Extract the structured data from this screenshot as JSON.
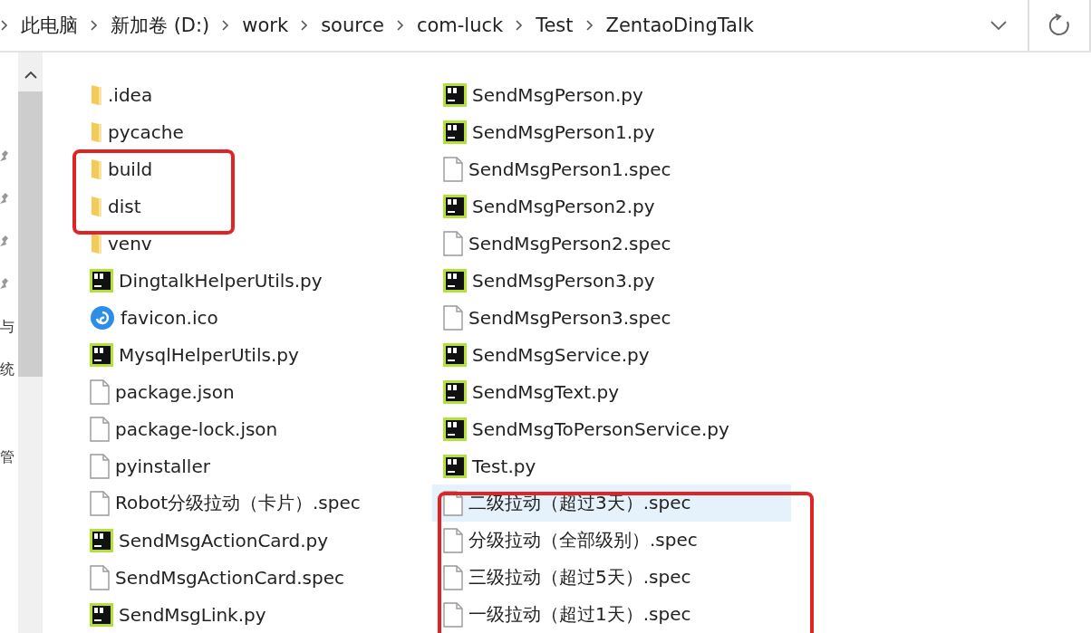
{
  "breadcrumb": {
    "segments": [
      "此电脑",
      "新加卷 (D:)",
      "work",
      "source",
      "com-luck",
      "Test",
      "ZentaoDingTalk"
    ]
  },
  "nav": [
    {
      "kind": "pin"
    },
    {
      "kind": "pin"
    },
    {
      "kind": "pin"
    },
    {
      "kind": "pin"
    },
    {
      "kind": "label",
      "text": "与"
    },
    {
      "kind": "label",
      "text": "统"
    },
    {
      "kind": "label",
      "text": "管"
    }
  ],
  "columns": [
    {
      "items": [
        {
          "name": ".idea",
          "kind": "folder",
          "selected": false
        },
        {
          "name": "pycache",
          "kind": "folder",
          "selected": false
        },
        {
          "name": "build",
          "kind": "folder",
          "selected": false
        },
        {
          "name": "dist",
          "kind": "folder",
          "selected": false
        },
        {
          "name": "venv",
          "kind": "folder",
          "selected": false
        },
        {
          "name": "DingtalkHelperUtils.py",
          "kind": "python",
          "selected": false
        },
        {
          "name": "favicon.ico",
          "kind": "ico",
          "selected": false
        },
        {
          "name": "MysqlHelperUtils.py",
          "kind": "python",
          "selected": false
        },
        {
          "name": "package.json",
          "kind": "file",
          "selected": false
        },
        {
          "name": "package-lock.json",
          "kind": "file",
          "selected": false
        },
        {
          "name": "pyinstaller",
          "kind": "file",
          "selected": false
        },
        {
          "name": "Robot分级拉动（卡片）.spec",
          "kind": "file",
          "selected": false
        },
        {
          "name": "SendMsgActionCard.py",
          "kind": "python",
          "selected": false
        },
        {
          "name": "SendMsgActionCard.spec",
          "kind": "file",
          "selected": false
        },
        {
          "name": "SendMsgLink.py",
          "kind": "python",
          "selected": false
        }
      ]
    },
    {
      "items": [
        {
          "name": "SendMsgPerson.py",
          "kind": "python",
          "selected": false
        },
        {
          "name": "SendMsgPerson1.py",
          "kind": "python",
          "selected": false
        },
        {
          "name": "SendMsgPerson1.spec",
          "kind": "file",
          "selected": false
        },
        {
          "name": "SendMsgPerson2.py",
          "kind": "python",
          "selected": false
        },
        {
          "name": "SendMsgPerson2.spec",
          "kind": "file",
          "selected": false
        },
        {
          "name": "SendMsgPerson3.py",
          "kind": "python",
          "selected": false
        },
        {
          "name": "SendMsgPerson3.spec",
          "kind": "file",
          "selected": false
        },
        {
          "name": "SendMsgService.py",
          "kind": "python",
          "selected": false
        },
        {
          "name": "SendMsgText.py",
          "kind": "python",
          "selected": false
        },
        {
          "name": "SendMsgToPersonService.py",
          "kind": "python",
          "selected": false
        },
        {
          "name": "Test.py",
          "kind": "python",
          "selected": false
        },
        {
          "name": "二级拉动（超过3天）.spec",
          "kind": "file",
          "selected": true
        },
        {
          "name": "分级拉动（全部级别）.spec",
          "kind": "file",
          "selected": false
        },
        {
          "name": "三级拉动（超过5天）.spec",
          "kind": "file",
          "selected": false
        },
        {
          "name": "一级拉动（超过1天）.spec",
          "kind": "file",
          "selected": false
        }
      ]
    }
  ]
}
